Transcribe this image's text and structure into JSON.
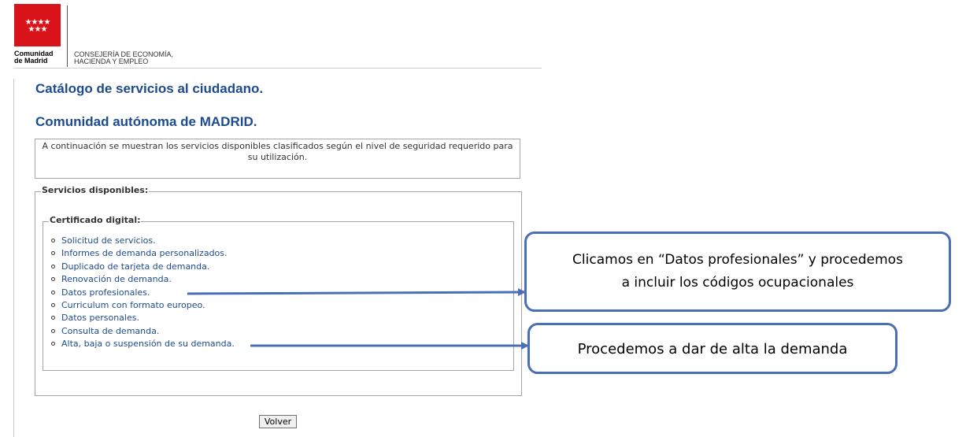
{
  "header": {
    "logo_name": "Comunidad de Madrid",
    "logo_line1": "Comunidad",
    "logo_line2": "de Madrid",
    "department_line1": "CONSEJERÍA DE ECONOMÍA,",
    "department_line2": "HACIENDA Y EMPLEO",
    "stars": "★★★★\n★★★"
  },
  "page": {
    "title": "Catálogo de servicios al ciudadano.",
    "subtitle": "Comunidad autónoma de MADRID.",
    "intro": "A continuación se muestran los servicios disponibles clasificados según el nivel de seguridad requerido para su utilización."
  },
  "services": {
    "legend": "Servicios disponibles:",
    "group_legend": "Certificado digital:",
    "items": [
      "Solicitud de servicios.",
      "Informes de demanda personalizados.",
      "Duplicado de tarjeta de demanda.",
      "Renovación de demanda.",
      "Datos profesionales.",
      "Curriculum con formato europeo.",
      "Datos personales.",
      "Consulta de demanda.",
      "Alta, baja o suspensión de su demanda."
    ]
  },
  "buttons": {
    "back_label": "Volver"
  },
  "annotations": {
    "callout_1_line1": "Clicamos en “Datos profesionales” y procedemos",
    "callout_1_line2": "a incluir los códigos ocupacionales",
    "callout_2": "Procedemos a dar de alta la demanda",
    "color": "#4a6fb4"
  },
  "colors": {
    "brand_red": "#d8131a",
    "title_blue": "#1d4b8f",
    "link_blue": "#1d4b8f"
  }
}
